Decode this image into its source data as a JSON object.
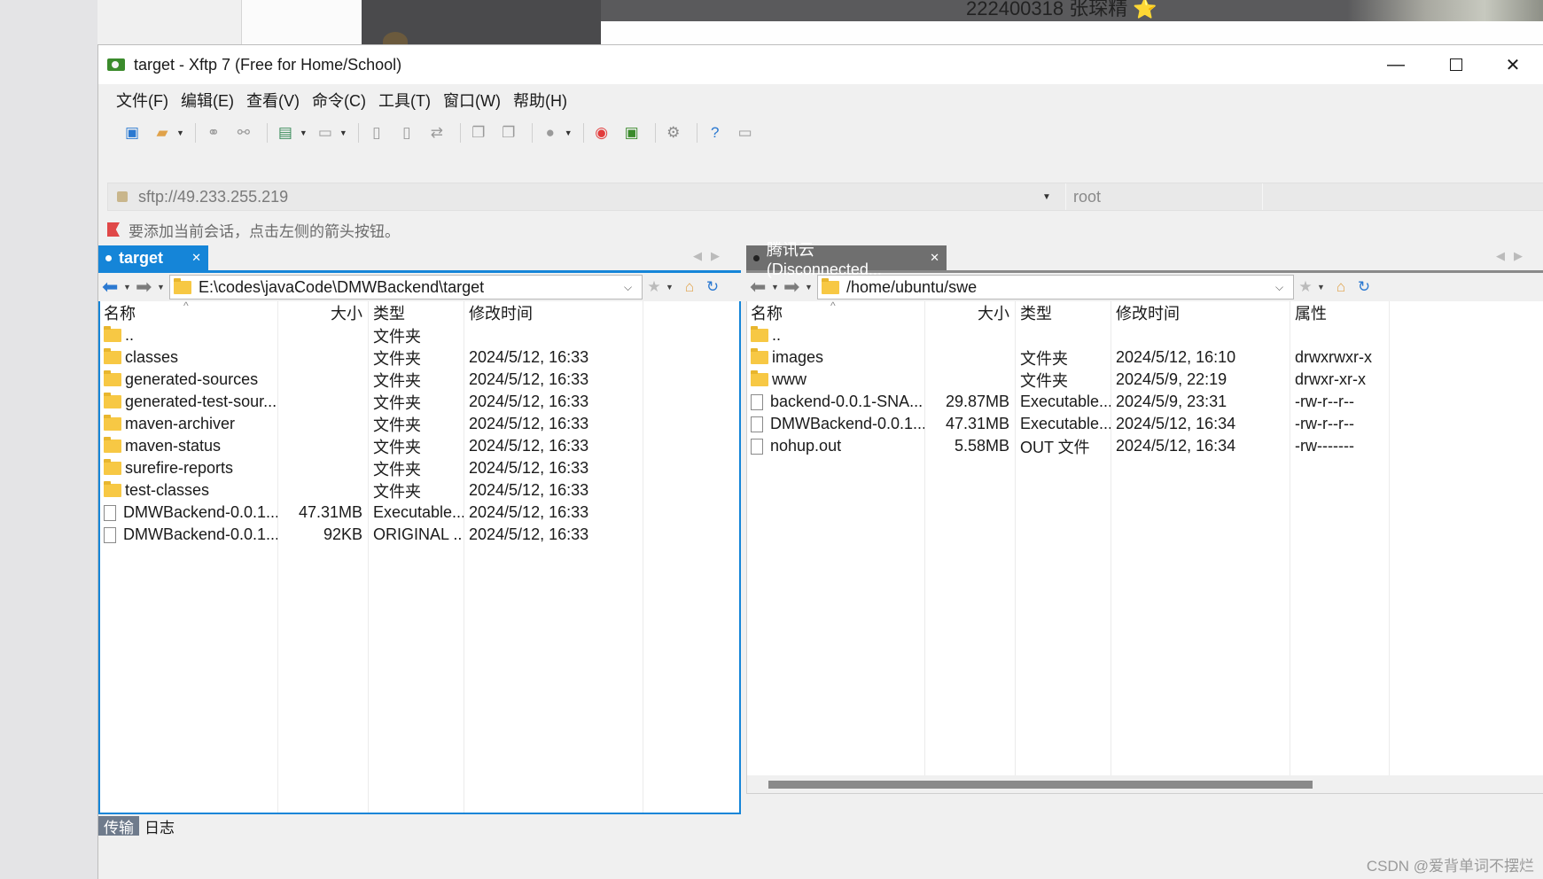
{
  "window": {
    "title": "target - Xftp 7 (Free for Home/School)"
  },
  "background": {
    "top_text": "222400318 张琛精 ⭐"
  },
  "menu": [
    "文件(F)",
    "编辑(E)",
    "查看(V)",
    "命令(C)",
    "工具(T)",
    "窗口(W)",
    "帮助(H)"
  ],
  "address": {
    "url": "sftp://49.233.255.219",
    "user_placeholder": "root"
  },
  "hint": "要添加当前会话，点击左侧的箭头按钮。",
  "left": {
    "tab_label": "target",
    "path": "E:\\codes\\javaCode\\DMWBackend\\target",
    "columns": [
      "名称",
      "大小",
      "类型",
      "修改时间"
    ],
    "rows": [
      {
        "name": "..",
        "size": "",
        "type": "文件夹",
        "time": "",
        "kind": "folder"
      },
      {
        "name": "classes",
        "size": "",
        "type": "文件夹",
        "time": "2024/5/12, 16:33",
        "kind": "folder"
      },
      {
        "name": "generated-sources",
        "size": "",
        "type": "文件夹",
        "time": "2024/5/12, 16:33",
        "kind": "folder"
      },
      {
        "name": "generated-test-sour...",
        "size": "",
        "type": "文件夹",
        "time": "2024/5/12, 16:33",
        "kind": "folder"
      },
      {
        "name": "maven-archiver",
        "size": "",
        "type": "文件夹",
        "time": "2024/5/12, 16:33",
        "kind": "folder"
      },
      {
        "name": "maven-status",
        "size": "",
        "type": "文件夹",
        "time": "2024/5/12, 16:33",
        "kind": "folder"
      },
      {
        "name": "surefire-reports",
        "size": "",
        "type": "文件夹",
        "time": "2024/5/12, 16:33",
        "kind": "folder"
      },
      {
        "name": "test-classes",
        "size": "",
        "type": "文件夹",
        "time": "2024/5/12, 16:33",
        "kind": "folder"
      },
      {
        "name": "DMWBackend-0.0.1...",
        "size": "47.31MB",
        "type": "Executable...",
        "time": "2024/5/12, 16:33",
        "kind": "file"
      },
      {
        "name": "DMWBackend-0.0.1...",
        "size": "92KB",
        "type": "ORIGINAL ...",
        "time": "2024/5/12, 16:33",
        "kind": "file"
      }
    ]
  },
  "right": {
    "tab_label": "腾讯云 (Disconnected...",
    "path": "/home/ubuntu/swe",
    "columns": [
      "名称",
      "大小",
      "类型",
      "修改时间",
      "属性"
    ],
    "rows": [
      {
        "name": "..",
        "size": "",
        "type": "",
        "time": "",
        "attr": "",
        "kind": "folder"
      },
      {
        "name": "images",
        "size": "",
        "type": "文件夹",
        "time": "2024/5/12, 16:10",
        "attr": "drwxrwxr-x",
        "kind": "folder"
      },
      {
        "name": "www",
        "size": "",
        "type": "文件夹",
        "time": "2024/5/9, 22:19",
        "attr": "drwxr-xr-x",
        "kind": "folder"
      },
      {
        "name": "backend-0.0.1-SNA...",
        "size": "29.87MB",
        "type": "Executable...",
        "time": "2024/5/9, 23:31",
        "attr": "-rw-r--r--",
        "kind": "file"
      },
      {
        "name": "DMWBackend-0.0.1...",
        "size": "47.31MB",
        "type": "Executable...",
        "time": "2024/5/12, 16:34",
        "attr": "-rw-r--r--",
        "kind": "file"
      },
      {
        "name": "nohup.out",
        "size": "5.58MB",
        "type": "OUT 文件",
        "time": "2024/5/12, 16:34",
        "attr": "-rw-------",
        "kind": "file"
      }
    ]
  },
  "bottom_tabs": [
    "传输",
    "日志"
  ],
  "watermark": "CSDN @爱背单词不摆烂",
  "colors": {
    "accent": "#1585d8",
    "folder": "#f7c844",
    "inactive_tab": "#6f6f6f"
  }
}
